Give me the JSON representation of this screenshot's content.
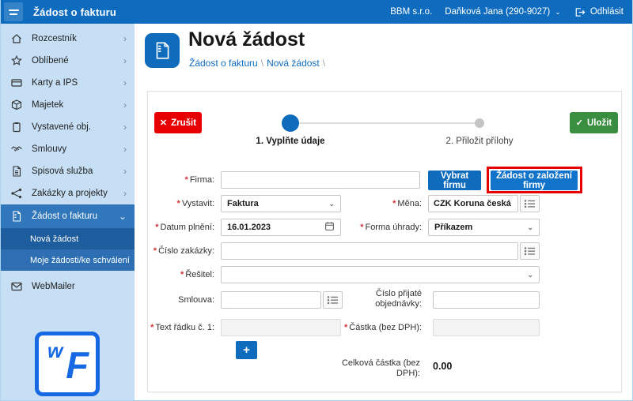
{
  "topbar": {
    "title": "Žádost o fakturu",
    "company": "BBM s.r.o.",
    "user": "Daňková Jana (290-9027)",
    "logout_label": "Odhlásit"
  },
  "sidebar": {
    "items": [
      {
        "label": "Rozcestník"
      },
      {
        "label": "Oblíbené"
      },
      {
        "label": "Karty a IPS"
      },
      {
        "label": "Majetek"
      },
      {
        "label": "Vystavené obj."
      },
      {
        "label": "Smlouvy"
      },
      {
        "label": "Spisová služba"
      },
      {
        "label": "Zakázky a projekty"
      },
      {
        "label": "Žádost o fakturu",
        "expanded": true
      },
      {
        "label": "Nová žádost",
        "active": true
      },
      {
        "label": "Moje žádosti/ke schválení"
      },
      {
        "label": "WebMailer"
      }
    ],
    "logo_w": "w",
    "logo_f": "F"
  },
  "header": {
    "title": "Nová žádost",
    "breadcrumb_1": "Žádost o fakturu",
    "breadcrumb_2": "Nová žádost",
    "separator": "\\"
  },
  "wizard": {
    "cancel_label": "Zrušit",
    "save_label": "Uložit",
    "step1": "1. Vyplňte údaje",
    "step2": "2. Přiložit přílohy"
  },
  "form": {
    "required_marker": "*",
    "firma": {
      "label": "Firma:",
      "value": ""
    },
    "vybrat_firmu_label": "Vybrat firmu",
    "zadost_zalozeni_label": "Žádost o založení firmy",
    "vystavit": {
      "label": "Vystavit:",
      "value": "Faktura"
    },
    "mena": {
      "label": "Měna:",
      "value": "CZK Koruna česká"
    },
    "datum_plneni": {
      "label": "Datum plnění:",
      "value": "16.01.2023"
    },
    "forma_uhrady": {
      "label": "Forma úhrady:",
      "value": "Příkazem"
    },
    "cislo_zakazky": {
      "label": "Číslo zakázky:",
      "value": ""
    },
    "resitel": {
      "label": "Řešitel:",
      "value": ""
    },
    "smlouva": {
      "label": "Smlouva:",
      "value": ""
    },
    "cislo_prijate_objednavky": {
      "label": "Číslo přijaté objednávky:",
      "value": ""
    },
    "text_radku": {
      "label": "Text řádku č. 1:",
      "value": ""
    },
    "castka": {
      "label": "Částka (bez DPH):",
      "value": ""
    },
    "add_row_label": "+",
    "celkova_castka": {
      "label": "Celková částka (bez DPH):",
      "value": "0.00"
    }
  },
  "icons": {
    "chevron_right": "›",
    "chevron_down": "⌄",
    "close": "✕",
    "check": "✓"
  },
  "colors": {
    "topbar_blue": "#0e6bbd",
    "accent_blue": "#0f6cbd",
    "sidebar_bg": "#c7dff4",
    "nav_parent_bg": "#3077bb",
    "nav_active_bg": "#1d5c9d",
    "nav_sub_bg": "#2d6fb2",
    "cancel_red": "#e60000",
    "save_green": "#3a8e3f",
    "annotation_red": "#e60000"
  }
}
